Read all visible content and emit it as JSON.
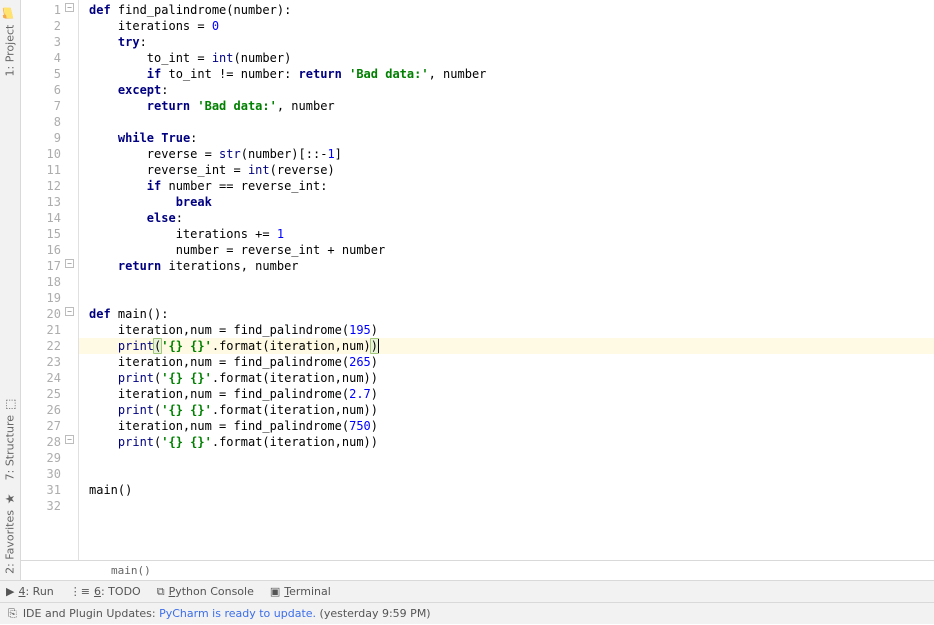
{
  "sidebar": {
    "top": {
      "label": "1: Project",
      "icon": "📁"
    },
    "mid": {
      "label": "7: Structure",
      "icon": "⬚"
    },
    "bot": {
      "label": "2: Favorites",
      "icon": "★"
    }
  },
  "highlight_line": 22,
  "code_lines": [
    {
      "n": 1,
      "fold": "-",
      "indent": 0,
      "tokens": [
        {
          "t": "def ",
          "c": "kw"
        },
        {
          "t": "find_palindrome",
          "c": "fn"
        },
        {
          "t": "(number):",
          "c": "op"
        }
      ]
    },
    {
      "n": 2,
      "fold": "",
      "indent": 1,
      "tokens": [
        {
          "t": "iterations = ",
          "c": "op"
        },
        {
          "t": "0",
          "c": "num"
        }
      ]
    },
    {
      "n": 3,
      "fold": "",
      "indent": 1,
      "tokens": [
        {
          "t": "try",
          "c": "kw"
        },
        {
          "t": ":",
          "c": "op"
        }
      ]
    },
    {
      "n": 4,
      "fold": "",
      "indent": 2,
      "tokens": [
        {
          "t": "to_int = ",
          "c": "op"
        },
        {
          "t": "int",
          "c": "bi"
        },
        {
          "t": "(number)",
          "c": "op"
        }
      ]
    },
    {
      "n": 5,
      "fold": "",
      "indent": 2,
      "tokens": [
        {
          "t": "if ",
          "c": "kw"
        },
        {
          "t": "to_int != number: ",
          "c": "op"
        },
        {
          "t": "return ",
          "c": "kw"
        },
        {
          "t": "'Bad data:'",
          "c": "str"
        },
        {
          "t": ", number",
          "c": "op"
        }
      ]
    },
    {
      "n": 6,
      "fold": "",
      "indent": 1,
      "tokens": [
        {
          "t": "except",
          "c": "kw"
        },
        {
          "t": ":",
          "c": "op"
        }
      ]
    },
    {
      "n": 7,
      "fold": "",
      "indent": 2,
      "tokens": [
        {
          "t": "return ",
          "c": "kw"
        },
        {
          "t": "'Bad data:'",
          "c": "str"
        },
        {
          "t": ", number",
          "c": "op"
        }
      ]
    },
    {
      "n": 8,
      "fold": "",
      "indent": 0,
      "tokens": []
    },
    {
      "n": 9,
      "fold": "",
      "indent": 1,
      "tokens": [
        {
          "t": "while ",
          "c": "kw"
        },
        {
          "t": "True",
          "c": "kw"
        },
        {
          "t": ":",
          "c": "op"
        }
      ]
    },
    {
      "n": 10,
      "fold": "",
      "indent": 2,
      "tokens": [
        {
          "t": "reverse = ",
          "c": "op"
        },
        {
          "t": "str",
          "c": "bi"
        },
        {
          "t": "(number)[::-",
          "c": "op"
        },
        {
          "t": "1",
          "c": "num"
        },
        {
          "t": "]",
          "c": "op"
        }
      ]
    },
    {
      "n": 11,
      "fold": "",
      "indent": 2,
      "tokens": [
        {
          "t": "reverse_int = ",
          "c": "op"
        },
        {
          "t": "int",
          "c": "bi"
        },
        {
          "t": "(reverse)",
          "c": "op"
        }
      ]
    },
    {
      "n": 12,
      "fold": "",
      "indent": 2,
      "tokens": [
        {
          "t": "if ",
          "c": "kw"
        },
        {
          "t": "number == reverse_int:",
          "c": "op"
        }
      ]
    },
    {
      "n": 13,
      "fold": "",
      "indent": 3,
      "tokens": [
        {
          "t": "break",
          "c": "kw"
        }
      ]
    },
    {
      "n": 14,
      "fold": "",
      "indent": 2,
      "tokens": [
        {
          "t": "else",
          "c": "kw"
        },
        {
          "t": ":",
          "c": "op"
        }
      ]
    },
    {
      "n": 15,
      "fold": "",
      "indent": 3,
      "tokens": [
        {
          "t": "iterations += ",
          "c": "op"
        },
        {
          "t": "1",
          "c": "num"
        }
      ]
    },
    {
      "n": 16,
      "fold": "",
      "indent": 3,
      "tokens": [
        {
          "t": "number = reverse_int + number",
          "c": "op"
        }
      ]
    },
    {
      "n": 17,
      "fold": "-",
      "indent": 1,
      "tokens": [
        {
          "t": "return ",
          "c": "kw"
        },
        {
          "t": "iterations, number",
          "c": "op"
        }
      ]
    },
    {
      "n": 18,
      "fold": "",
      "indent": 0,
      "tokens": []
    },
    {
      "n": 19,
      "fold": "",
      "indent": 0,
      "tokens": []
    },
    {
      "n": 20,
      "fold": "-",
      "indent": 0,
      "tokens": [
        {
          "t": "def ",
          "c": "kw"
        },
        {
          "t": "main",
          "c": "fn"
        },
        {
          "t": "():",
          "c": "op"
        }
      ]
    },
    {
      "n": 21,
      "fold": "",
      "indent": 1,
      "tokens": [
        {
          "t": "iteration,num = find_palindrome(",
          "c": "op"
        },
        {
          "t": "195",
          "c": "num"
        },
        {
          "t": ")",
          "c": "op"
        }
      ]
    },
    {
      "n": 22,
      "fold": "",
      "indent": 1,
      "hl": true,
      "caret": true,
      "tokens": [
        {
          "t": "print",
          "c": "bi"
        },
        {
          "t": "(",
          "c": "op match"
        },
        {
          "t": "'{} {}'",
          "c": "str"
        },
        {
          "t": ".format(iteration,num)",
          "c": "op"
        },
        {
          "t": ")",
          "c": "op match"
        }
      ]
    },
    {
      "n": 23,
      "fold": "",
      "indent": 1,
      "tokens": [
        {
          "t": "iteration,num = find_palindrome(",
          "c": "op"
        },
        {
          "t": "265",
          "c": "num"
        },
        {
          "t": ")",
          "c": "op"
        }
      ]
    },
    {
      "n": 24,
      "fold": "",
      "indent": 1,
      "tokens": [
        {
          "t": "print",
          "c": "bi"
        },
        {
          "t": "(",
          "c": "op"
        },
        {
          "t": "'{} {}'",
          "c": "str"
        },
        {
          "t": ".format(iteration,num))",
          "c": "op"
        }
      ]
    },
    {
      "n": 25,
      "fold": "",
      "indent": 1,
      "tokens": [
        {
          "t": "iteration,num = find_palindrome(",
          "c": "op"
        },
        {
          "t": "2.7",
          "c": "num"
        },
        {
          "t": ")",
          "c": "op"
        }
      ]
    },
    {
      "n": 26,
      "fold": "",
      "indent": 1,
      "tokens": [
        {
          "t": "print",
          "c": "bi"
        },
        {
          "t": "(",
          "c": "op"
        },
        {
          "t": "'{} {}'",
          "c": "str"
        },
        {
          "t": ".format(iteration,num))",
          "c": "op"
        }
      ]
    },
    {
      "n": 27,
      "fold": "",
      "indent": 1,
      "tokens": [
        {
          "t": "iteration,num = find_palindrome(",
          "c": "op"
        },
        {
          "t": "750",
          "c": "num"
        },
        {
          "t": ")",
          "c": "op"
        }
      ]
    },
    {
      "n": 28,
      "fold": "-",
      "indent": 1,
      "tokens": [
        {
          "t": "print",
          "c": "bi"
        },
        {
          "t": "(",
          "c": "op"
        },
        {
          "t": "'{} {}'",
          "c": "str"
        },
        {
          "t": ".format(iteration,num))",
          "c": "op"
        }
      ]
    },
    {
      "n": 29,
      "fold": "",
      "indent": 0,
      "tokens": []
    },
    {
      "n": 30,
      "fold": "",
      "indent": 0,
      "tokens": []
    },
    {
      "n": 31,
      "fold": "",
      "indent": 0,
      "tokens": [
        {
          "t": "main()",
          "c": "op"
        }
      ]
    },
    {
      "n": 32,
      "fold": "",
      "indent": 0,
      "tokens": []
    }
  ],
  "breadcrumb": "main()",
  "toolwindows": [
    {
      "icon": "▶",
      "label_pre": "",
      "label_u": "4",
      "label_post": ": Run"
    },
    {
      "icon": "⋮≡",
      "label_pre": "",
      "label_u": "6",
      "label_post": ": TODO"
    },
    {
      "icon": "⧉",
      "label_pre": "",
      "label_u": "P",
      "label_post": "ython Console"
    },
    {
      "icon": "▣",
      "label_pre": "",
      "label_u": "T",
      "label_post": "erminal"
    }
  ],
  "status": {
    "icon": "⎘",
    "prefix": "IDE and Plugin Updates: ",
    "link": "PyCharm is ready to update.",
    "suffix": " (yesterday 9:59 PM)"
  }
}
